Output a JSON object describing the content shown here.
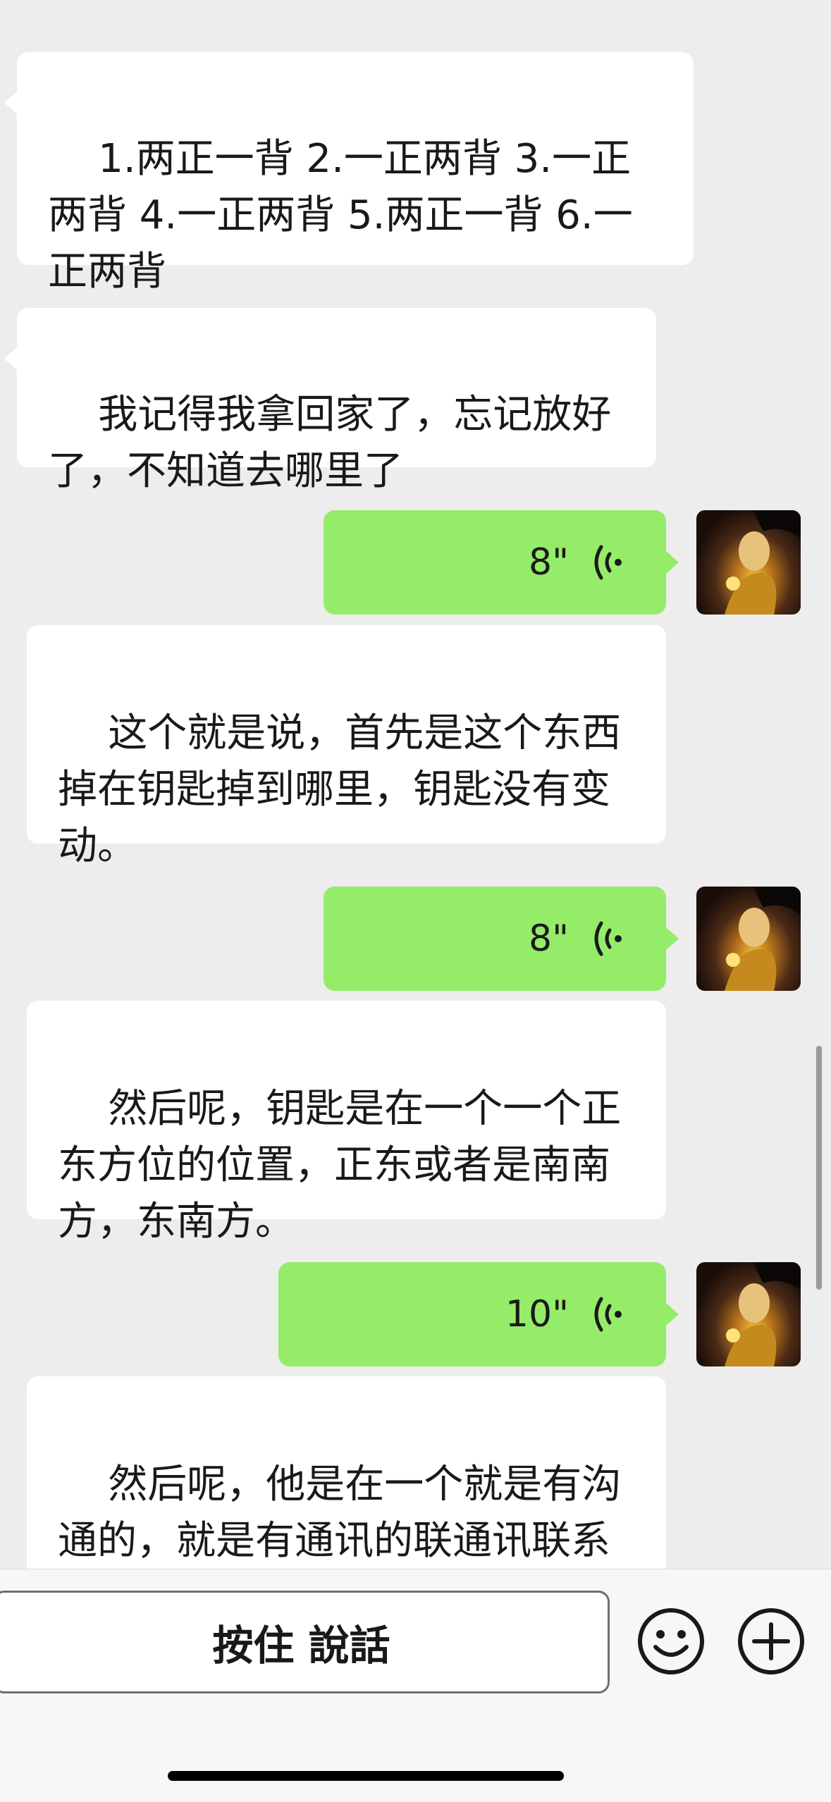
{
  "messages": [
    {
      "type": "text",
      "side": "left",
      "text": "1.两正一背 2.一正两背 3.一正两背 4.一正两背 5.两正一背 6.一正两背"
    },
    {
      "type": "text",
      "side": "left",
      "text": "我记得我拿回家了，忘记放好了，不知道去哪里了"
    },
    {
      "type": "voice",
      "side": "right",
      "duration": "8\""
    },
    {
      "type": "transcript",
      "text": "这个就是说，首先是这个东西掉在钥匙掉到哪里，钥匙没有变动。"
    },
    {
      "type": "voice",
      "side": "right",
      "duration": "8\""
    },
    {
      "type": "transcript",
      "text": "然后呢，钥匙是在一个一个正东方位的位置，正东或者是南南方，东南方。"
    },
    {
      "type": "voice",
      "side": "right",
      "duration": "10\""
    },
    {
      "type": "transcript",
      "text": "然后呢，他是在一个就是有沟通的，就是有通讯的联通讯联系说话的一些东西下面。"
    }
  ],
  "input_bar": {
    "hold_to_talk_label": "按住 說話",
    "emoji_icon": "smiley-face-icon",
    "more_icon": "plus-circle-icon"
  },
  "colors": {
    "background": "#ededed",
    "incoming_bubble": "#ffffff",
    "outgoing_bubble": "#95ec69",
    "text": "#191919"
  }
}
